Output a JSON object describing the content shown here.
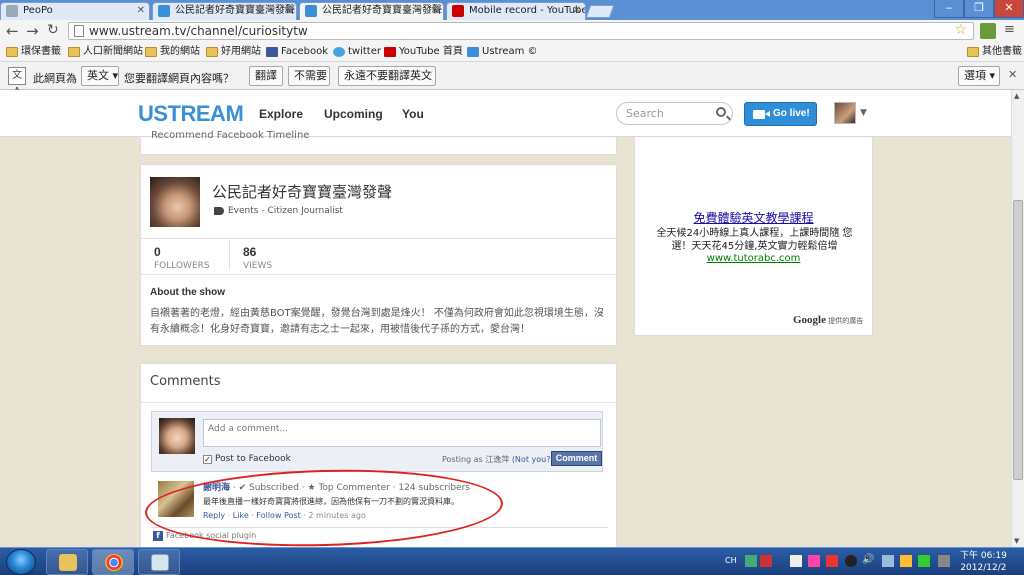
{
  "browser": {
    "tabs": [
      {
        "label": "PeoPo",
        "active": false
      },
      {
        "label": "公民記者好奇寶寶臺灣發聲",
        "active": false
      },
      {
        "label": "公民記者好奇寶寶臺灣發聲",
        "active": true
      },
      {
        "label": "Mobile record - YouTube",
        "active": false
      }
    ],
    "url": "www.ustream.tv/channel/curiositytw",
    "bookmarks": [
      "環保書籤",
      "人口新聞網站",
      "我的網站",
      "好用網站",
      "Facebook",
      "twitter",
      "YouTube 首頁",
      "Ustream ©"
    ],
    "other_bookmarks": "其他書籤"
  },
  "translate_bar": {
    "prefix": "此網頁為",
    "language": "英文",
    "question": "您要翻譯網頁內容嗎？",
    "translate": "翻譯",
    "no": "不需要",
    "never": "永遠不要翻譯英文",
    "options": "選項"
  },
  "ustream": {
    "logo": "USTREAM",
    "nav": [
      "Explore",
      "Upcoming",
      "You"
    ],
    "search_placeholder": "Search",
    "go_live": "Go live!"
  },
  "show": {
    "cut_text": "Recommend   Facebook   Timeline",
    "title": "公民記者好奇寶寶臺灣發聲",
    "category": "Events - Citizen Journalist",
    "followers_value": "0",
    "followers_label": "FOLLOWERS",
    "views_value": "86",
    "views_label": "VIEWS",
    "about_heading": "About the show",
    "about_text": "自襯著著的老燈，經由黃慈BOT案覺醒，發覺台灣到處是烽火！ 不僅為何政府會如此忽視環境生態，沒有永續概念！化身好奇寶寶，邀請有志之士一起來，用被惜後代子孫的方式，愛台灣！"
  },
  "comments": {
    "heading": "Comments",
    "input_placeholder": "Add a comment...",
    "post_to_fb": "Post to Facebook",
    "posting_as": "Posting as 江逸萍",
    "not_you": "(Not you?)",
    "comment_button": "Comment",
    "items": [
      {
        "author": "謝明海",
        "meta": " · ✔ Subscribed · ★ Top Commenter · 124 subscribers",
        "text": "最年後直播一樣好奇寶寶將很進總，因為他保有一刀不劃的實況資料庫。",
        "reply": "Reply",
        "like": "Like",
        "follow": "Follow Post",
        "time": "2 minutes ago"
      }
    ],
    "plugin_label": "Facebook social plugin"
  },
  "ad": {
    "link": "免費體驗英文教學課程",
    "text": "全天候24小時線上真人課程，上課時間隨 您選！天天花45分鐘,英文實力輕鬆倍增",
    "url": "www.tutorabc.com",
    "google_brand": "Google",
    "google_label": "提供的廣告"
  },
  "taskbar": {
    "lang": "CH",
    "time": "下午 06:19",
    "date": "2012/12/2"
  }
}
